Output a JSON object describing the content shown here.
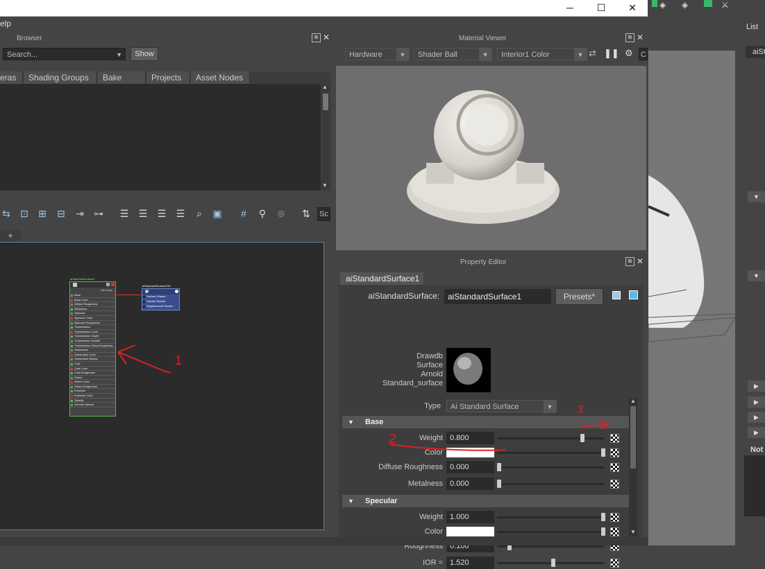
{
  "menubar": {
    "help_label": "elp"
  },
  "browser": {
    "title": "Browser",
    "search_placeholder": "Search...",
    "show_label": "Show",
    "tabs": [
      "eras",
      "Shading Groups",
      "Bake Sets",
      "Projects",
      "Asset Nodes"
    ]
  },
  "node_editor": {
    "add_tab_label": "+",
    "zoom_field": "Sc",
    "material_node": {
      "title": "aiStandardSurface1",
      "out_label": "Out Color",
      "attributes": [
        "Base",
        "Base Color",
        "Diffuse Roughness",
        "Metalness",
        "Specular",
        "Specular Color",
        "Specular Roughness",
        "Transmission",
        "Transmission Color",
        "Transmission Depth",
        "Transmission Scatter",
        "Transmission Extra Roughness",
        "Subsurface",
        "Subsurface Color",
        "Subsurface Radius",
        "Coat",
        "Coat Color",
        "Coat Roughness",
        "Sheen",
        "Sheen Color",
        "Sheen Roughness",
        "Emission",
        "Emission Color",
        "Opacity",
        "Normal Camera"
      ]
    },
    "sg_node": {
      "title": "aiStandardSurface1SG",
      "attributes": [
        "Surface Shader",
        "Volume Shader",
        "Displacement Shader"
      ]
    },
    "annotation_1": "1"
  },
  "material_viewer": {
    "title": "Material Viewer",
    "renderer": "Hardware",
    "shape": "Shader Ball",
    "environment": "Interior1 Color",
    "extra_dropdown": "C"
  },
  "property_editor": {
    "title": "Property Editor",
    "tab": "aiStandardSurface1",
    "node_type_label": "aiStandardSurface:",
    "node_name": "aiStandardSurface1",
    "presets_label": "Presets*",
    "swatch_classification": [
      "Drawdb",
      "Surface",
      "Arnold",
      "Standard_surface"
    ],
    "type_label": "Type",
    "type_value": "Ai Standard Surface",
    "sections": [
      {
        "title": "Base",
        "rows": [
          {
            "label": "Weight",
            "value": "0.800",
            "slider": 0.8
          },
          {
            "label": "Color",
            "value": "",
            "slider": 1.0
          },
          {
            "label": "Diffuse Roughness",
            "value": "0.000",
            "slider": 0.0
          },
          {
            "label": "Metalness",
            "value": "0.000",
            "slider": 0.0
          }
        ]
      },
      {
        "title": "Specular",
        "rows": [
          {
            "label": "Weight",
            "value": "1.000",
            "slider": 1.0
          },
          {
            "label": "Color",
            "value": "",
            "slider": 1.0
          },
          {
            "label": "Roughness",
            "value": "0.100",
            "slider": 0.1
          },
          {
            "label": "IOR =",
            "value": "1.520",
            "slider": 0.52
          }
        ]
      }
    ],
    "annotation_2": "2",
    "annotation_3": "3"
  },
  "right_strip": {
    "list_label": "List",
    "tab_label": "aiSt",
    "notes_label": "Not"
  },
  "colors": {
    "accent_red": "#e02020",
    "node_sg_blue": "#3a4d8f",
    "panel_bg": "#444444"
  }
}
